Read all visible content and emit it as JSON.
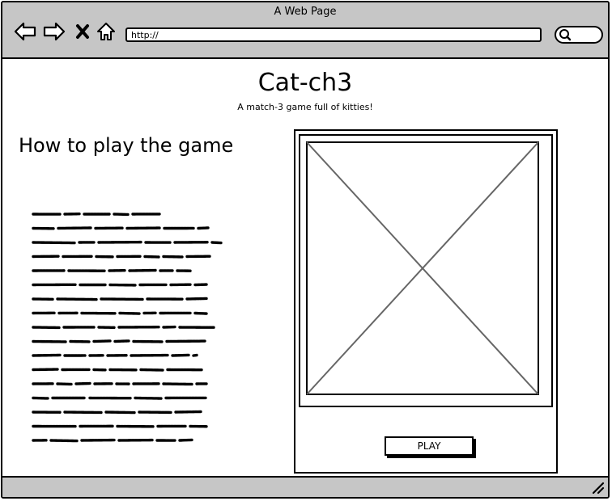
{
  "window": {
    "title": "A Web Page"
  },
  "toolbar": {
    "icons": [
      "back-arrow-icon",
      "forward-arrow-icon",
      "stop-icon",
      "home-icon",
      "search-icon"
    ],
    "url": "http://"
  },
  "page": {
    "title": "Cat-ch3",
    "subtitle": "A match-3 game full of kitties!",
    "section_heading": "How to play the game",
    "instructions_placeholder": "scribbled-text-block"
  },
  "game": {
    "board_placeholder": "image-placeholder",
    "play_label": "PLAY"
  },
  "colors": {
    "chrome": "#c6c6c6",
    "background": "#ffffff",
    "ink": "#000000",
    "placeholder_cross": "#666666"
  }
}
